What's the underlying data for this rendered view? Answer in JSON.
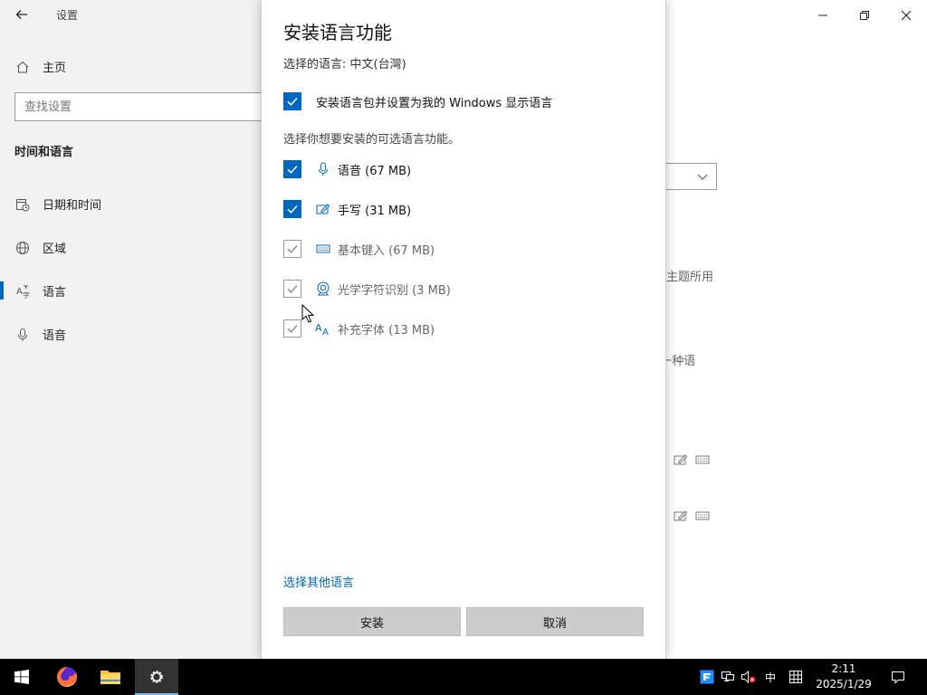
{
  "window": {
    "app_title": "设置",
    "search_placeholder": "查找设置",
    "home_label": "主页",
    "section_title": "时间和语言",
    "nav": [
      {
        "label": "日期和时间",
        "icon": "calendar-clock-icon"
      },
      {
        "label": "区域",
        "icon": "globe-icon"
      },
      {
        "label": "语言",
        "icon": "language-icon"
      },
      {
        "label": "语音",
        "icon": "microphone-icon"
      }
    ],
    "active_nav": "语言",
    "background_text": {
      "line1": "主题所用",
      "line2": ")一种语"
    }
  },
  "dialog": {
    "title": "安装语言功能",
    "selected_language": "选择的语言: 中文(台灣)",
    "display_language_option": {
      "label": "安装语言包并设置为我的 Windows 显示语言",
      "checked": true
    },
    "instruction": "选择你想要安装的可选语言功能。",
    "features": [
      {
        "label": "语音 (67 MB)",
        "icon": "microphone-icon",
        "checked": true,
        "enabled": true
      },
      {
        "label": "手写 (31 MB)",
        "icon": "handwriting-pen-icon",
        "checked": true,
        "enabled": true
      },
      {
        "label": "基本键入 (67 MB)",
        "icon": "keyboard-icon",
        "checked": true,
        "enabled": false
      },
      {
        "label": "光学字符识别 (3 MB)",
        "icon": "ocr-camera-icon",
        "checked": true,
        "enabled": false
      },
      {
        "label": "补充字体 (13 MB)",
        "icon": "font-icon",
        "checked": true,
        "enabled": false
      }
    ],
    "other_language_link": "选择其他语言",
    "install_button": "安装",
    "cancel_button": "取消"
  },
  "taskbar": {
    "apps": [
      {
        "name": "start-button",
        "icon": "windows-logo-icon"
      },
      {
        "name": "firefox",
        "icon": "firefox-icon"
      },
      {
        "name": "file-explorer",
        "icon": "folder-icon"
      },
      {
        "name": "settings",
        "icon": "gear-icon",
        "active": true
      }
    ],
    "tray": {
      "ime": "中",
      "time": "2:11",
      "date": "2025/1/29"
    }
  },
  "colors": {
    "accent": "#0067c0",
    "link": "#0067b8",
    "sidebar_bg": "#f2f2f2",
    "button_bg": "#cccccc",
    "taskbar_bg": "#000000"
  }
}
